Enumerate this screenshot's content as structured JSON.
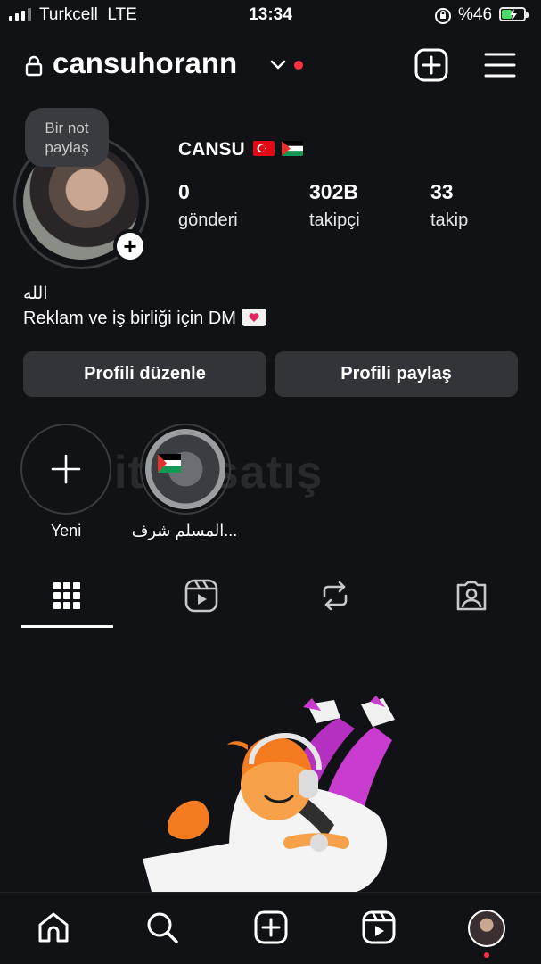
{
  "status_bar": {
    "carrier": "Turkcell",
    "network": "LTE",
    "time": "13:34",
    "battery": "%46",
    "battery_level": 0.46,
    "icons": [
      "signal-icon",
      "rotation-lock-icon",
      "battery-charging-icon"
    ]
  },
  "header": {
    "username": "cansuhorann",
    "icons": [
      "lock-icon",
      "chevron-down-icon",
      "new-post-icon",
      "menu-icon"
    ],
    "notification_color": "#ff3040"
  },
  "note_bubble": {
    "line1": "Bir not",
    "line2": "paylaş"
  },
  "profile": {
    "display_name": "CANSU",
    "flags": [
      "turkey-flag",
      "palestine-flag"
    ],
    "stats": [
      {
        "value": "0",
        "label": "gönderi"
      },
      {
        "value": "302B",
        "label": "takipçi"
      },
      {
        "value": "33",
        "label": "takip"
      }
    ],
    "bio_line1": "الله",
    "bio_line2": "Reklam ve iş birliği için DM"
  },
  "actions": {
    "edit_profile": "Profili düzenle",
    "share_profile": "Profili paylaş"
  },
  "highlights": [
    {
      "label": "Yeni",
      "icon": "plus-icon"
    },
    {
      "label": "المسلم شرف..."
    }
  ],
  "watermark": "itemsatış",
  "tabs": [
    {
      "name": "grid-icon",
      "active": true
    },
    {
      "name": "reels-icon",
      "active": false
    },
    {
      "name": "reposts-icon",
      "active": false
    },
    {
      "name": "tagged-icon",
      "active": false
    }
  ],
  "bottom_nav": [
    "home-icon",
    "search-icon",
    "create-icon",
    "reels-icon",
    "profile-avatar"
  ],
  "colors": {
    "background": "#111216",
    "button": "#33343a",
    "accent_red": "#ff3040",
    "battery_green": "#4cd964"
  }
}
